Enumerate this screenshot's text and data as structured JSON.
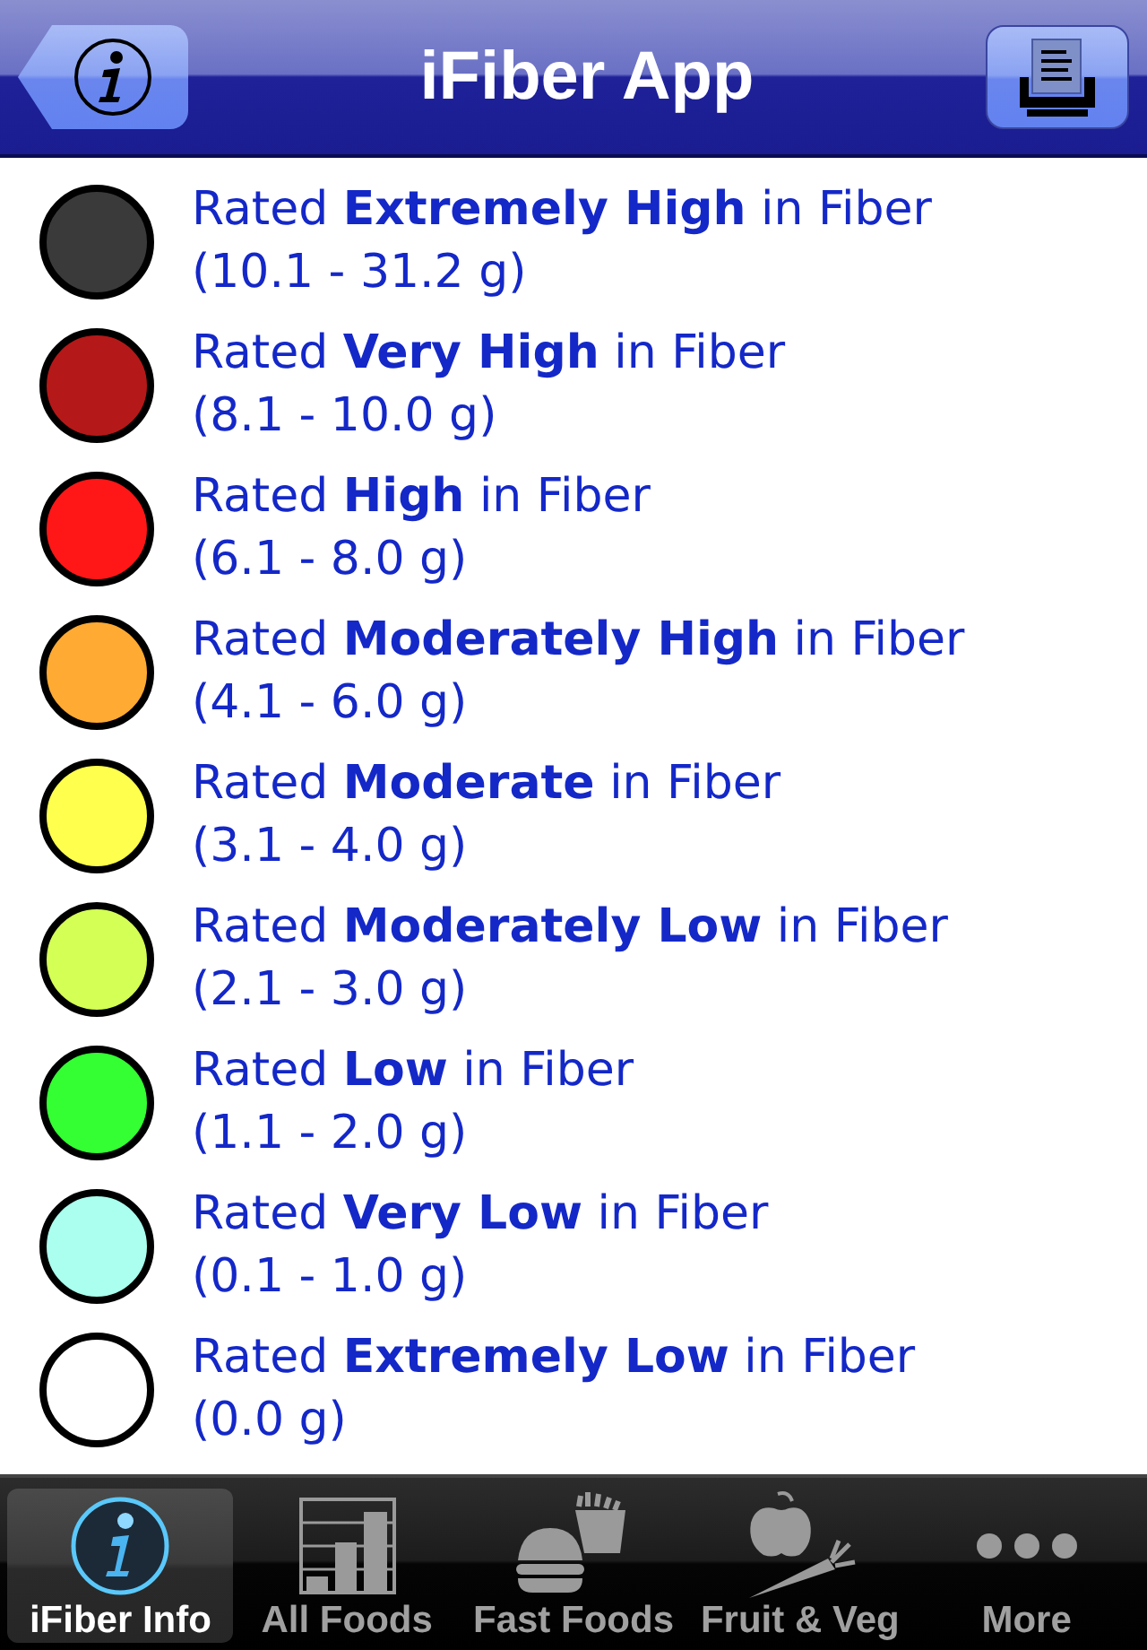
{
  "nav": {
    "title": "iFiber App"
  },
  "legend": [
    {
      "label": "Rated **Extremely High** in Fiber",
      "range": "(10.1 - 31.2 g)",
      "color": "#3a3a3a"
    },
    {
      "label": "Rated **Very High** in Fiber",
      "range": "(8.1 - 10.0 g)",
      "color": "#b51818"
    },
    {
      "label": "Rated **High** in Fiber",
      "range": "(6.1 - 8.0 g)",
      "color": "#ff1717"
    },
    {
      "label": "Rated **Moderately High** in Fiber",
      "range": "(4.1 - 6.0 g)",
      "color": "#ffaa33"
    },
    {
      "label": "Rated **Moderate** in Fiber",
      "range": "(3.1 - 4.0 g)",
      "color": "#ffff4d"
    },
    {
      "label": "Rated **Moderately Low** in Fiber",
      "range": "(2.1 - 3.0 g)",
      "color": "#d4ff55"
    },
    {
      "label": "Rated **Low** in Fiber",
      "range": "(1.1 - 2.0 g)",
      "color": "#33ff33"
    },
    {
      "label": "Rated **Very Low** in Fiber",
      "range": "(0.1 - 1.0 g)",
      "color": "#aaffee"
    },
    {
      "label": "Rated **Extremely Low** in Fiber",
      "range": "(0.0 g)",
      "color": "#ffffff"
    }
  ],
  "tabs": [
    {
      "label": "iFiber Info",
      "kind": "info",
      "selected": true
    },
    {
      "label": "All Foods",
      "kind": "chart",
      "selected": false
    },
    {
      "label": "Fast Foods",
      "kind": "fastfood",
      "selected": false
    },
    {
      "label": "Fruit & Veg",
      "kind": "produce",
      "selected": false
    },
    {
      "label": "More",
      "kind": "more",
      "selected": false
    }
  ]
}
